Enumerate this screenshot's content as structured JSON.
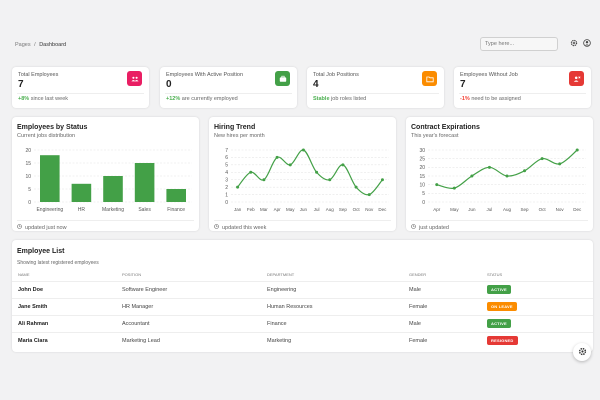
{
  "breadcrumb": {
    "parent": "Pages",
    "separator": "/",
    "current": "Dashboard"
  },
  "search": {
    "placeholder": "Type here..."
  },
  "stats": [
    {
      "label": "Total Employees",
      "value": "7",
      "highlight": "+8%",
      "highlight_color": "#4caf50",
      "note": "since last week",
      "icon": "people-icon",
      "icon_color": "#e91e63"
    },
    {
      "label": "Employees With Active Position",
      "value": "0",
      "highlight": "+12%",
      "highlight_color": "#4caf50",
      "note": "are currently employed",
      "icon": "briefcase-icon",
      "icon_color": "#43a047"
    },
    {
      "label": "Total Job Positions",
      "value": "4",
      "highlight": "Stable",
      "highlight_color": "#4caf50",
      "note": "job roles listed",
      "icon": "folder-icon",
      "icon_color": "#fb8c00"
    },
    {
      "label": "Employees Without Job",
      "value": "7",
      "highlight": "-1%",
      "highlight_color": "#f44336",
      "note": "need to be assigned",
      "icon": "user-x-icon",
      "icon_color": "#e53935"
    }
  ],
  "charts_meta": [
    {
      "title": "Employees by Status",
      "subtitle": "Current jobs distribution",
      "footer": "updated just now"
    },
    {
      "title": "Hiring Trend",
      "subtitle": "New hires per month",
      "footer": "updated this week"
    },
    {
      "title": "Contract Expirations",
      "subtitle": "This year's forecast",
      "footer": "just updated"
    }
  ],
  "chart_data": [
    {
      "type": "bar",
      "title": "Employees by Status",
      "categories": [
        "Engineering",
        "HR",
        "Marketing",
        "Sales",
        "Finance"
      ],
      "values": [
        18,
        7,
        10,
        15,
        5
      ],
      "ylim": [
        0,
        20
      ],
      "yticks": [
        0,
        5,
        10,
        15,
        20
      ],
      "grid": true,
      "color": "#43a047"
    },
    {
      "type": "line",
      "title": "Hiring Trend",
      "categories": [
        "Jan",
        "Feb",
        "Mar",
        "Apr",
        "May",
        "Jun",
        "Jul",
        "Aug",
        "Sep",
        "Oct",
        "Nov",
        "Dec"
      ],
      "values": [
        2,
        4,
        3,
        6,
        5,
        7,
        4,
        3,
        5,
        2,
        1,
        3
      ],
      "ylim": [
        0,
        7
      ],
      "yticks": [
        0,
        1,
        2,
        3,
        4,
        5,
        6,
        7
      ],
      "grid": true,
      "color": "#43a047"
    },
    {
      "type": "line",
      "title": "Contract Expirations",
      "categories": [
        "Apr",
        "May",
        "Jun",
        "Jul",
        "Aug",
        "Sep",
        "Oct",
        "Nov",
        "Dec"
      ],
      "values": [
        10,
        8,
        15,
        20,
        15,
        18,
        25,
        22,
        30
      ],
      "ylim": [
        0,
        30
      ],
      "yticks": [
        0,
        5,
        10,
        15,
        20,
        25,
        30
      ],
      "grid": true,
      "color": "#43a047"
    }
  ],
  "employees": {
    "title": "Employee List",
    "subtitle": "Showing latest registered employees",
    "columns": [
      "NAME",
      "POSITION",
      "DEPARTMENT",
      "GENDER",
      "STATUS"
    ],
    "rows": [
      {
        "name": "John Doe",
        "position": "Software Engineer",
        "department": "Engineering",
        "gender": "Male",
        "status": "ACTIVE",
        "status_color": "#43a047"
      },
      {
        "name": "Jane Smith",
        "position": "HR Manager",
        "department": "Human Resources",
        "gender": "Female",
        "status": "ON LEAVE",
        "status_color": "#fb8c00"
      },
      {
        "name": "Ali Rahman",
        "position": "Accountant",
        "department": "Finance",
        "gender": "Male",
        "status": "ACTIVE",
        "status_color": "#43a047"
      },
      {
        "name": "Maria Ciara",
        "position": "Marketing Lead",
        "department": "Marketing",
        "gender": "Female",
        "status": "RESIGNED",
        "status_color": "#e53935"
      }
    ]
  }
}
